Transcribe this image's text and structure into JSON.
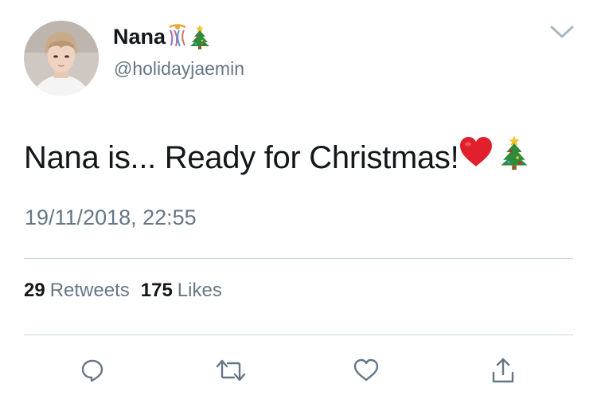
{
  "user": {
    "display_name": "Nana",
    "name_emojis": [
      "confetti-ball-icon",
      "christmas-tree-icon"
    ],
    "handle": "@holidayjaemin"
  },
  "tweet": {
    "text": "Nana is... Ready for Christmas!",
    "text_emojis": [
      "red-heart-icon",
      "christmas-tree-icon"
    ],
    "timestamp": "19/11/2018, 22:55"
  },
  "stats": {
    "retweets_count": "29",
    "retweets_label": "Retweets",
    "likes_count": "175",
    "likes_label": "Likes"
  },
  "actions": [
    "reply-icon",
    "retweet-icon",
    "like-icon",
    "share-icon"
  ],
  "colors": {
    "text_primary": "#14171a",
    "text_secondary": "#657786",
    "divider": "#ccd6dd",
    "heart": "#e0202c",
    "tree": "#2e8b3a"
  }
}
